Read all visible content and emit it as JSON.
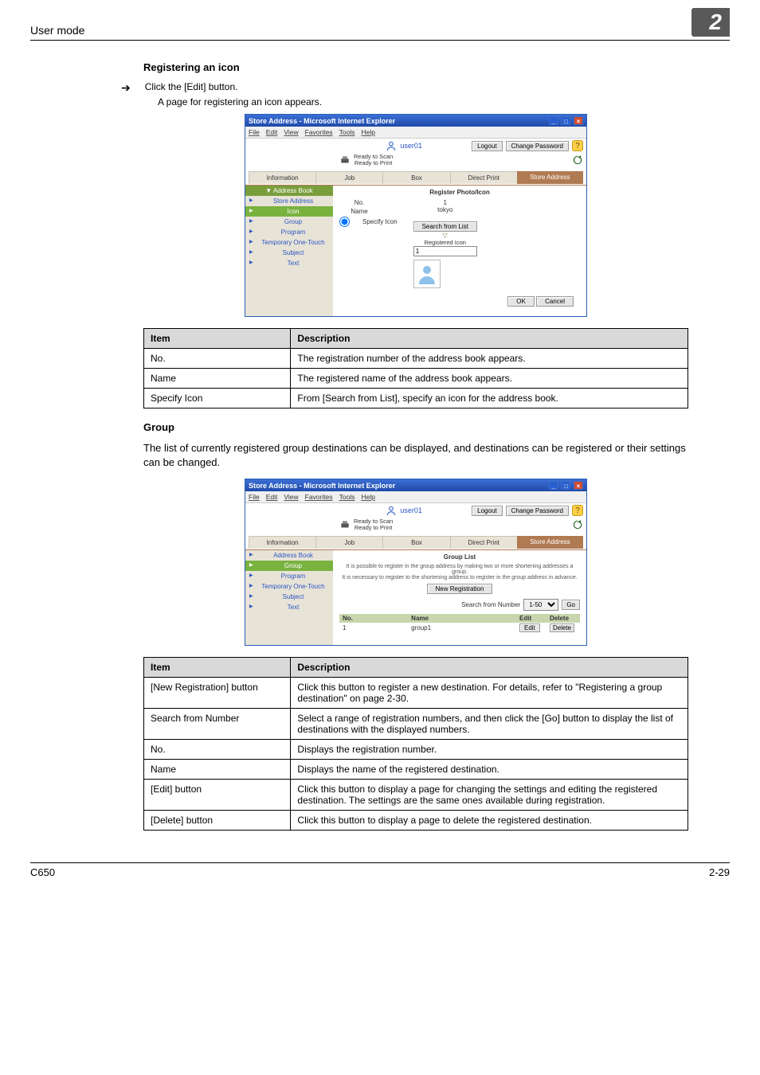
{
  "header": {
    "left": "User mode",
    "number": "2"
  },
  "section1": {
    "title": "Registering an icon",
    "bullet": "Click the [Edit] button.",
    "sub": "A page for registering an icon appears."
  },
  "browser_common": {
    "title": "Store Address - Microsoft Internet Explorer",
    "menu": [
      "File",
      "Edit",
      "View",
      "Favorites",
      "Tools",
      "Help"
    ],
    "user": "user01",
    "logout": "Logout",
    "change_pw": "Change Password",
    "status1": "Ready to Scan",
    "status2": "Ready to Print",
    "tabs": [
      "Information",
      "Job",
      "Box",
      "Direct Print",
      "Store Address"
    ]
  },
  "browser1": {
    "side_header": "Address Book",
    "side_items": [
      "Store Address",
      "Icon",
      "Group",
      "Program",
      "Temporary One-Touch",
      "Subject",
      "Text"
    ],
    "panel_title": "Register Photo/Icon",
    "no_label": "No.",
    "no_value": "1",
    "name_label": "Name",
    "name_value": "tokyo",
    "specify": "Specify Icon",
    "search_btn": "Search from List",
    "reg_icon_label": "Registered Icon",
    "reg_icon_value": "1",
    "ok": "OK",
    "cancel": "Cancel"
  },
  "table1": {
    "h1": "Item",
    "h2": "Description",
    "rows": [
      {
        "item": "No.",
        "desc": "The registration number of the address book appears."
      },
      {
        "item": "Name",
        "desc": "The registered name of the address book appears."
      },
      {
        "item": "Specify Icon",
        "desc": "From [Search from List], specify an icon for the address book."
      }
    ]
  },
  "section2": {
    "title": "Group",
    "body": "The list of currently registered group destinations can be displayed, and destinations can be registered or their settings can be changed."
  },
  "browser2": {
    "side_items": [
      "Address Book",
      "Group",
      "Program",
      "Temporary One-Touch",
      "Subject",
      "Text"
    ],
    "panel_title": "Group List",
    "note1": "It is possible to register in the group address by making two or more shortening addresses a group.",
    "note2": "It is necessary to register to the shortening address to register in the group address in advance.",
    "new_reg": "New Registration",
    "search_num": "Search from Number",
    "range": "1-50",
    "go": "Go",
    "th_no": "No.",
    "th_name": "Name",
    "th_edit": "Edit",
    "th_del": "Delete",
    "row_no": "1",
    "row_name": "group1",
    "row_edit": "Edit",
    "row_del": "Delete"
  },
  "table2": {
    "h1": "Item",
    "h2": "Description",
    "rows": [
      {
        "item": "[New Registration] button",
        "desc": "Click this button to register a new destination. For details, refer to \"Registering a group destination\" on page 2-30."
      },
      {
        "item": "Search from Number",
        "desc": "Select a range of registration numbers, and then click the [Go] button to display the list of destinations with the displayed numbers."
      },
      {
        "item": "No.",
        "desc": "Displays the registration number."
      },
      {
        "item": "Name",
        "desc": "Displays the name of the registered destination."
      },
      {
        "item": "[Edit] button",
        "desc": "Click this button to display a page for changing the settings and editing the registered destination. The settings are the same ones available during registration."
      },
      {
        "item": "[Delete] button",
        "desc": "Click this button to display a page to delete the registered destination."
      }
    ]
  },
  "footer": {
    "left": "C650",
    "right": "2-29"
  }
}
